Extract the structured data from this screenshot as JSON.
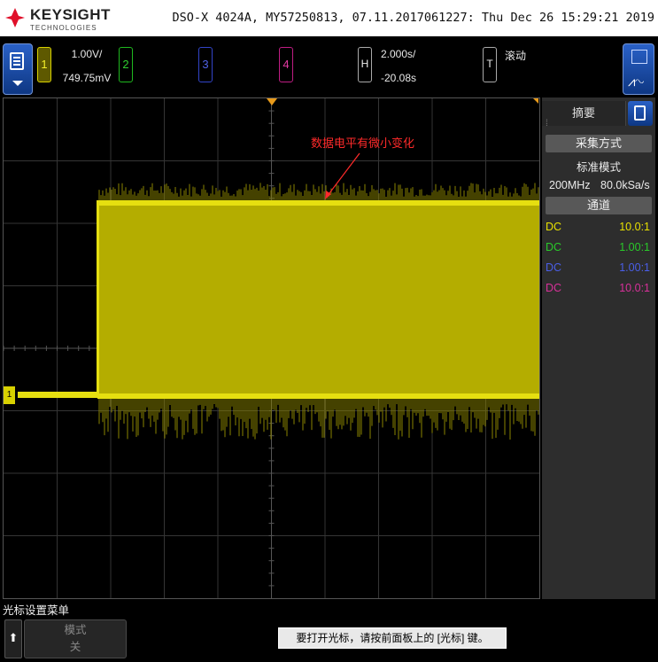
{
  "header": {
    "brand": "KEYSIGHT",
    "brand_sub": "TECHNOLOGIES",
    "device_info": "DSO-X 4024A, MY57250813, 07.11.2017061227: Thu Dec 26 15:29:21 2019"
  },
  "toolbar": {
    "menu_icon": "document-menu-icon",
    "channels": [
      {
        "label": "1",
        "color": "#d8d100",
        "scale": "1.00V/",
        "offset": "749.75mV"
      },
      {
        "label": "2",
        "color": "#1fb81f"
      },
      {
        "label": "3",
        "color": "#3244c8"
      },
      {
        "label": "4",
        "color": "#c01d84"
      }
    ],
    "horizontal": {
      "label": "H",
      "timebase": "2.000s/",
      "delay": "-20.08s"
    },
    "trigger": {
      "label": "T",
      "mode": "滚动"
    },
    "zoom_icon": "zoom-wave-icon"
  },
  "annotation": "数据电平有微小变化",
  "side_panel": {
    "title": "摘要",
    "acq_header": "采集方式",
    "acq_mode": "标准模式",
    "bandwidth": "200MHz",
    "sample_rate": "80.0kSa/s",
    "channel_header": "通道",
    "channels": [
      {
        "coupling": "DC",
        "probe": "10.0:1",
        "color": "#e8e000"
      },
      {
        "coupling": "DC",
        "probe": "1.00:1",
        "color": "#29c929"
      },
      {
        "coupling": "DC",
        "probe": "1.00:1",
        "color": "#4a5ee8"
      },
      {
        "coupling": "DC",
        "probe": "10.0:1",
        "color": "#d8309a"
      }
    ]
  },
  "bottom": {
    "menu_title": "光标设置菜单",
    "back_icon": "up-arrow-icon",
    "softkey": {
      "line1": "模式",
      "line2": "关"
    },
    "message": "要打开光标，请按前面板上的 [光标] 键。"
  },
  "waveform": {
    "trace_color": "#c7c000",
    "rise_fraction_of_screen": 0.16,
    "channel1_ground_marker": "1"
  }
}
